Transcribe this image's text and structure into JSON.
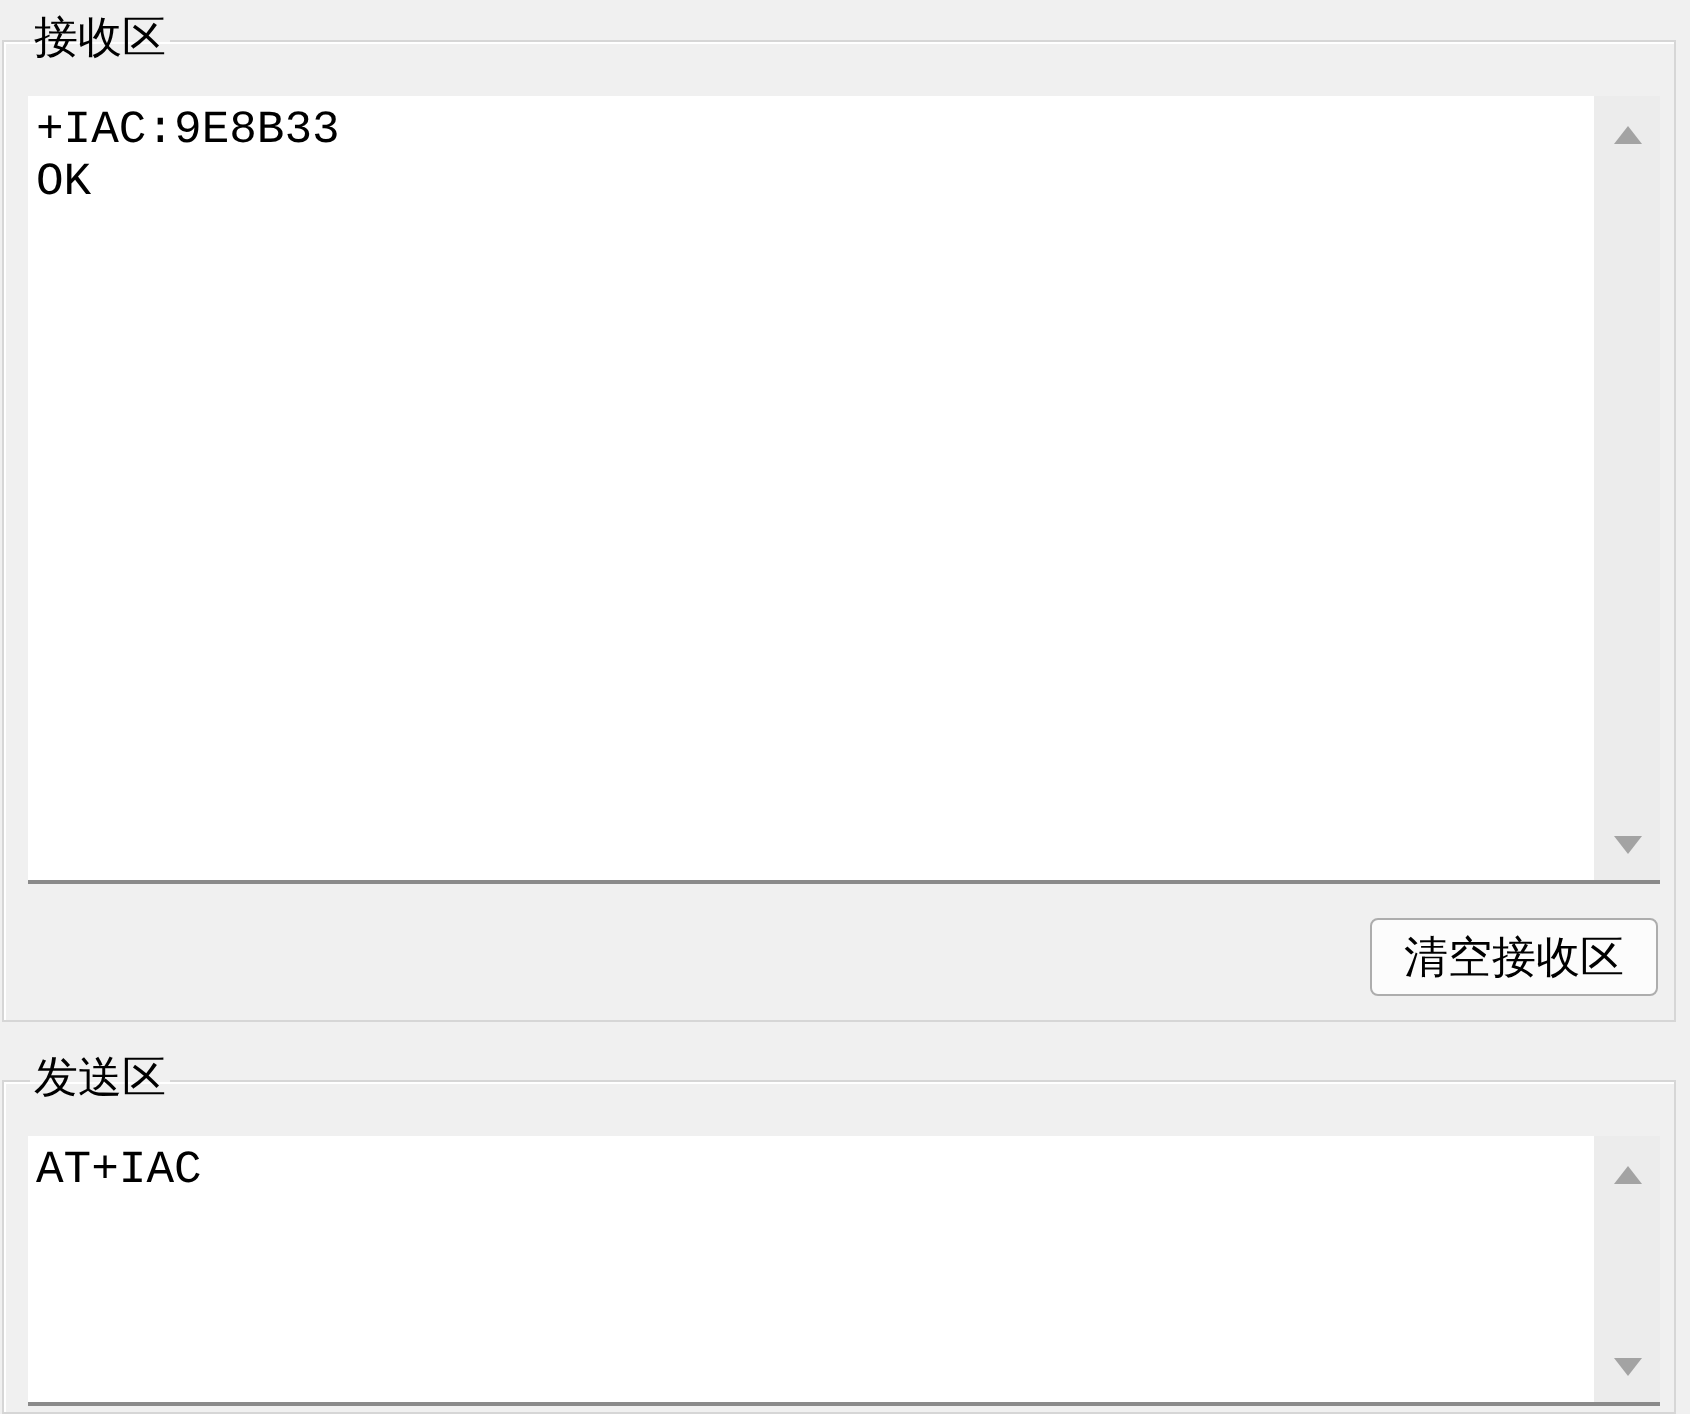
{
  "receive_group": {
    "title": "接收区",
    "text_lines": [
      "+IAC:9E8B33",
      "OK"
    ],
    "clear_button": "清空接收区"
  },
  "send_group": {
    "title": "发送区",
    "text_lines": [
      "AT+IAC"
    ]
  }
}
